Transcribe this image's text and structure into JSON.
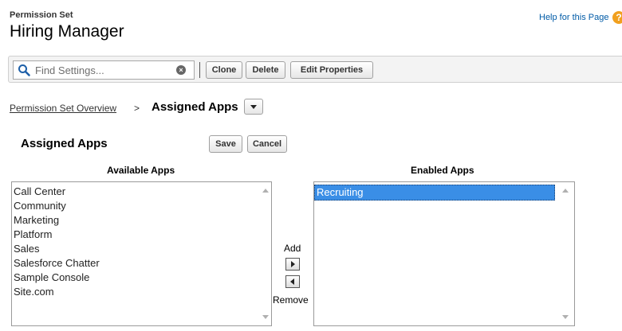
{
  "header": {
    "page_type_label": "Permission Set",
    "title": "Hiring Manager",
    "help_link": "Help for this Page",
    "help_icon": "question-icon"
  },
  "toolbar": {
    "search_placeholder": "Find Settings...",
    "clone_label": "Clone",
    "delete_label": "Delete",
    "edit_properties_label": "Edit Properties"
  },
  "breadcrumb": {
    "overview_link": "Permission Set Overview",
    "separator": ">",
    "current": "Assigned Apps"
  },
  "section": {
    "title": "Assigned Apps",
    "save_label": "Save",
    "cancel_label": "Cancel"
  },
  "available": {
    "header": "Available Apps",
    "items": [
      "Call Center",
      "Community",
      "Marketing",
      "Platform",
      "Sales",
      "Salesforce Chatter",
      "Sample Console",
      "Site.com"
    ]
  },
  "enabled": {
    "header": "Enabled Apps",
    "items": [
      "Recruiting"
    ],
    "selected": "Recruiting"
  },
  "controls": {
    "add_label": "Add",
    "remove_label": "Remove"
  },
  "colors": {
    "link_blue": "#015ba7",
    "selection_blue": "#3a8ee6",
    "help_orange": "#f1a01e",
    "toolbar_bg": "#f3f3f3"
  }
}
